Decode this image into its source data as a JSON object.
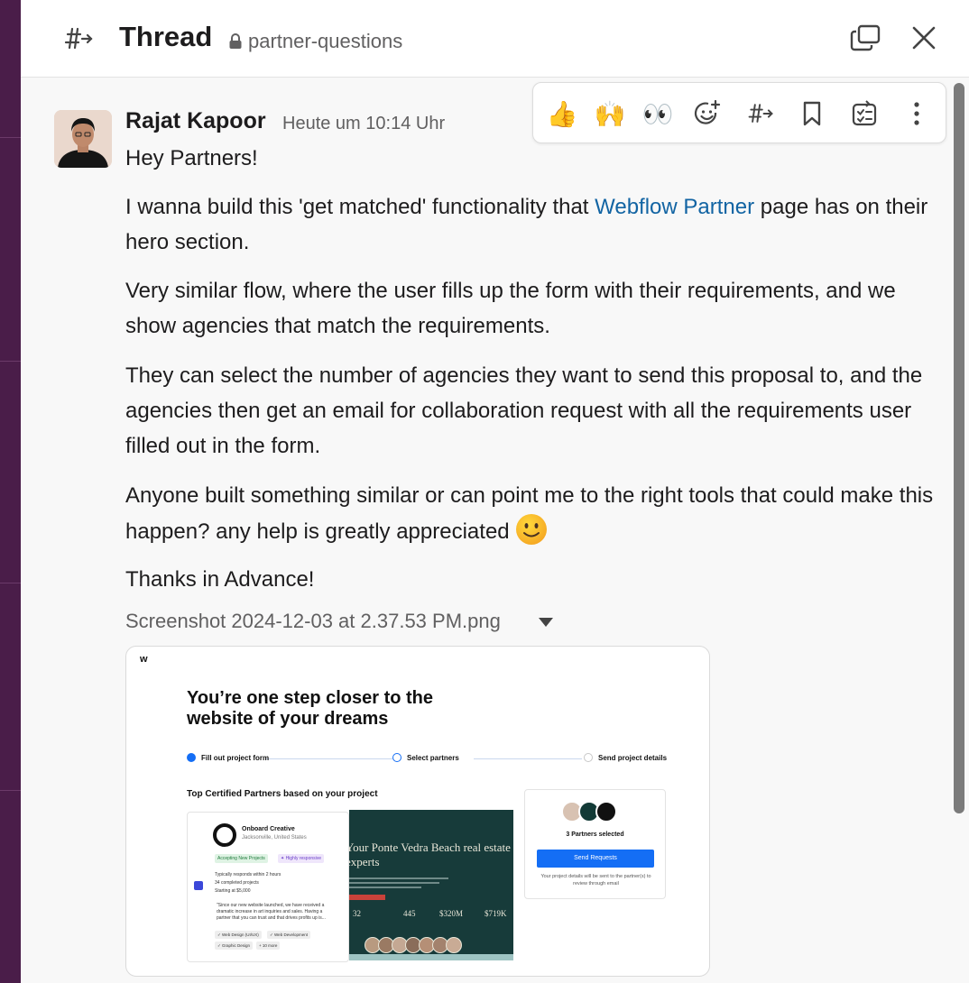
{
  "header": {
    "title": "Thread",
    "channel": "partner-questions",
    "icons": {
      "channel": "channel-forward-icon",
      "lock": "lock-icon",
      "popout": "popout-window-icon",
      "close": "close-icon"
    }
  },
  "message": {
    "author": "Rajat Kapoor",
    "timestamp": "Heute um 10:14 Uhr",
    "greeting": "Hey Partners!",
    "p1_before": "I wanna build this 'get matched' functionality that ",
    "p1_link": "Webflow Partner",
    "p1_after": " page has on their hero section.",
    "p2": "Very similar flow, where the user fills up the form with their requirements, and we show agencies that match the requirements.",
    "p3": "They can select the number of agencies they want to send this proposal to, and the agencies then get an email for collaboration request with all the requirements user filled out in the form.",
    "p4": "Anyone built something similar or can point me to the right tools that could make this happen? any help is greatly appreciated ",
    "p5": "Thanks in Advance!",
    "emoji": "slightly-smiling-face-icon"
  },
  "toolbar": {
    "items": [
      "thumbsup-emoji",
      "raised-hands-emoji",
      "eyes-emoji",
      "add-reaction-icon",
      "forward-to-channel-icon",
      "bookmark-icon",
      "create-task-icon",
      "more-actions-icon"
    ],
    "thumbsup": "👍",
    "hands": "🙌",
    "eyes": "👀"
  },
  "attachment": {
    "filename": "Screenshot 2024-12-03 at 2.37.53 PM.png",
    "preview": {
      "logo": "w",
      "heading": "You’re one step closer to the website of your dreams",
      "step1": "Fill out project form",
      "step2": "Select partners",
      "step3": "Send project details",
      "subheading": "Top Certified Partners based on your project",
      "card": {
        "name": "Onboard Creative",
        "location": "Jacksonville, United States",
        "tag1": "Accepting New Projects",
        "tag2": "✦ Highly responsive",
        "meta1": "Typically responds within 2 hours",
        "meta2": "34 completed projects",
        "meta3": "Starting at $5,000",
        "quote": "\"Since our new website launched, we have received a dramatic increase in art inquiries and sales. Having a partner that you can trust and that drives profits up is...",
        "chip1": "✓ Web Design (UI/UX)",
        "chip2": "✓ Web Development",
        "chip3": "✓ Graphic Design",
        "chip4": "+ 10 more"
      },
      "hero": {
        "title": "Your Ponte Vedra Beach real estate experts",
        "stat1": "32",
        "stat2": "445",
        "stat3": "$320M",
        "stat4": "$719K"
      },
      "selected": {
        "label": "3 Partners selected",
        "button": "Send Requests",
        "note": "Your project details will be sent to the partner(s) to review through email"
      }
    }
  },
  "colors": {
    "rail": "#4a1d49",
    "link": "#1264a3",
    "accent": "#146ef5"
  }
}
